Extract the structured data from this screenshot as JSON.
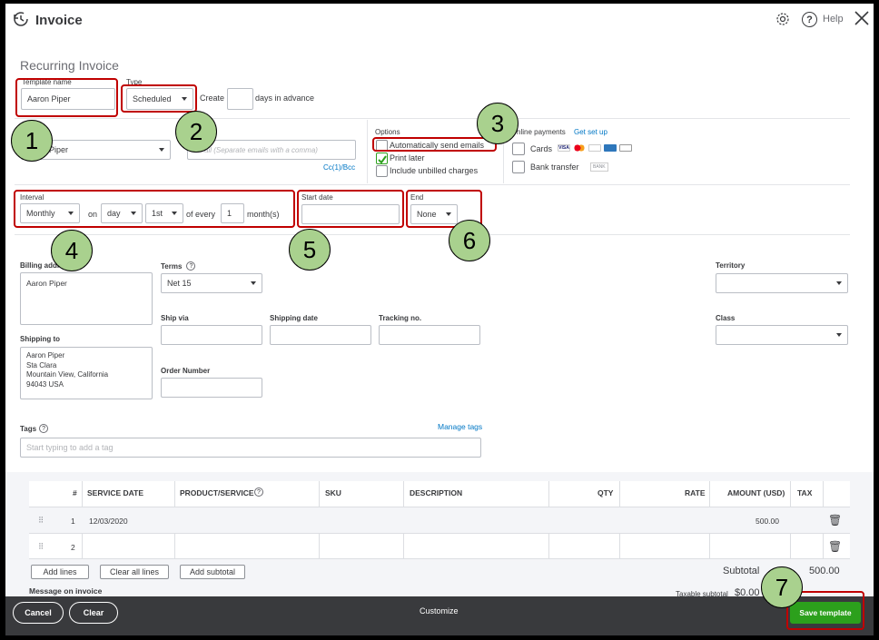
{
  "header": {
    "title": "Invoice",
    "help_label": "Help"
  },
  "form": {
    "heading": "Recurring Invoice",
    "template_name_label": "Template name",
    "template_name_value": "Aaron  Piper",
    "type_label": "Type",
    "type_value": "Scheduled",
    "create_label": "Create",
    "days_advance_label": "days in advance",
    "customer_value": "Piper",
    "email_placeholder": "Email (Separate emails with a comma)",
    "cc_bcc_label": "Cc(1)/Bcc",
    "options_label": "Options",
    "auto_send_label": "Automatically send emails",
    "print_later_label": "Print later",
    "include_unbilled_label": "Include unbilled charges",
    "online_payments_label": "nline payments",
    "get_set_up_label": "Get set up",
    "cards_label": "Cards",
    "bank_transfer_label": "Bank transfer",
    "bank_badge": "BANK",
    "interval_label": "Interval",
    "interval_value": "Monthly",
    "on_label": "on",
    "day_value": "day",
    "nth_value": "1st",
    "of_every_label": "of every",
    "every_value": "1",
    "months_label": "month(s)",
    "start_date_label": "Start date",
    "end_label": "End",
    "end_value": "None",
    "billing_address_label": "Billing addre",
    "billing_address_value": "Aaron Piper",
    "terms_label": "Terms",
    "terms_value": "Net 15",
    "territory_label": "Territory",
    "ship_via_label": "Ship via",
    "shipping_date_label": "Shipping date",
    "tracking_no_label": "Tracking no.",
    "class_label": "Class",
    "shipping_to_label": "Shipping to",
    "shipping_lines": [
      "Aaron Piper",
      "Sta Clara",
      "Mountain View, California",
      "94043 USA"
    ],
    "order_number_label": "Order Number",
    "tags_label": "Tags",
    "manage_tags_label": "Manage tags",
    "tags_placeholder": "Start typing to add a tag"
  },
  "table": {
    "headers": {
      "num": "#",
      "service_date": "SERVICE DATE",
      "product": "PRODUCT/SERVICE",
      "sku": "SKU",
      "description": "DESCRIPTION",
      "qty": "QTY",
      "rate": "RATE",
      "amount": "AMOUNT (USD)",
      "tax": "TAX"
    },
    "rows": [
      {
        "num": "1",
        "service_date": "12/03/2020",
        "amount": "500.00"
      },
      {
        "num": "2",
        "service_date": "",
        "amount": ""
      }
    ],
    "add_lines_label": "Add lines",
    "clear_all_lines_label": "Clear all lines",
    "add_subtotal_label": "Add subtotal",
    "subtotal_label": "Subtotal",
    "subtotal_value": "500.00",
    "taxable_subtotal_label": "Taxable subtotal",
    "taxable_subtotal_value": "$0.00",
    "message_label": "Message on invoice"
  },
  "footer": {
    "cancel_label": "Cancel",
    "clear_label": "Clear",
    "customize_label": "Customize",
    "save_template_label": "Save template"
  },
  "callouts": [
    "1",
    "2",
    "3",
    "4",
    "5",
    "6",
    "7"
  ],
  "colors": {
    "accent_green": "#2ca01c",
    "link_blue": "#0077c5",
    "annotation_red": "#c00000",
    "callout_green": "#a9d18e",
    "footer_dark": "#393a3d"
  }
}
